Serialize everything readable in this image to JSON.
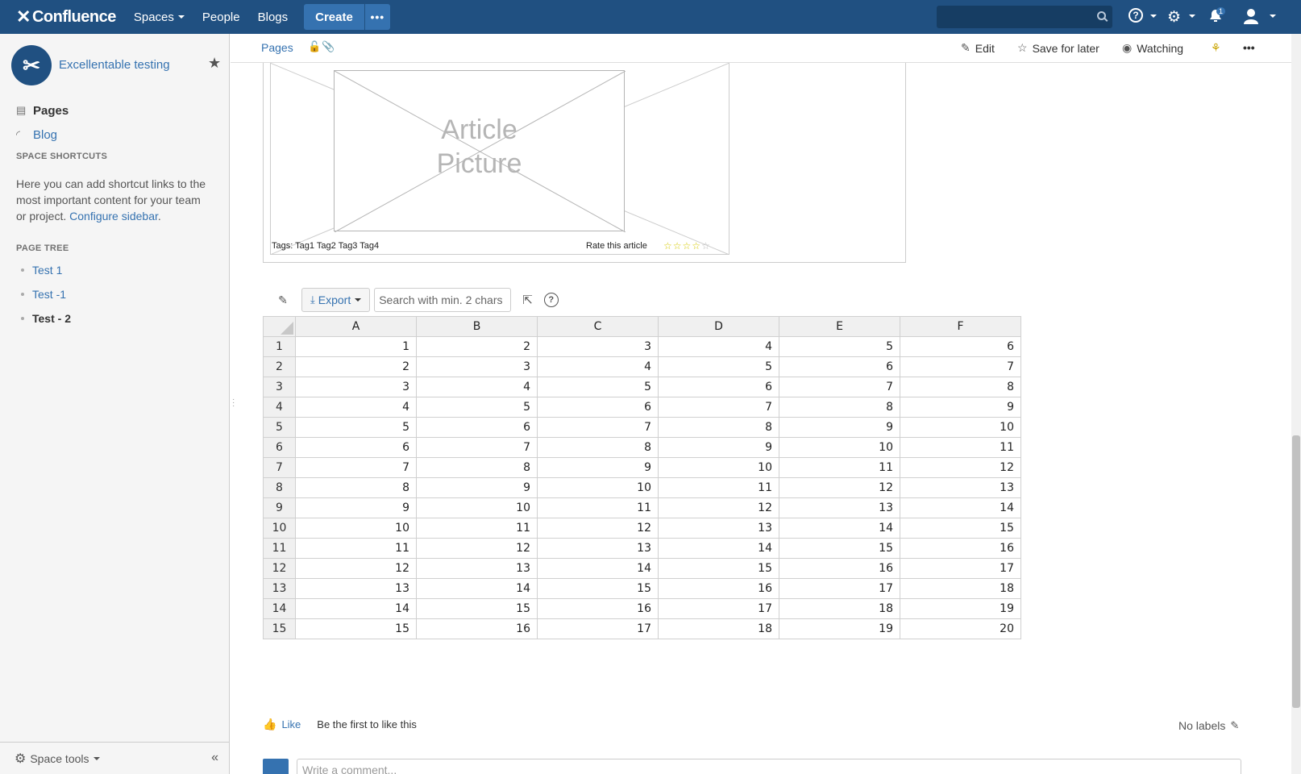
{
  "topnav": {
    "logo": "Confluence",
    "links": [
      "Spaces",
      "People",
      "Blogs"
    ],
    "create_label": "Create",
    "more_label": "•••",
    "notifications_count": "1"
  },
  "sidebar": {
    "space_name": "Excellentable testing",
    "nav": {
      "pages": "Pages",
      "blog": "Blog"
    },
    "shortcuts_heading": "SPACE SHORTCUTS",
    "shortcuts_text": "Here you can add shortcut links to the most important content for your team or project.",
    "configure_link": "Configure sidebar",
    "tree_heading": "PAGE TREE",
    "tree": [
      "Test 1",
      "Test -1",
      "Test - 2"
    ],
    "space_tools": "Space tools"
  },
  "page_header": {
    "breadcrumb": "Pages",
    "edit": "Edit",
    "save_for_later": "Save for later",
    "watching": "Watching"
  },
  "article": {
    "picture_line1": "Article",
    "picture_line2": "Picture",
    "tags": "Tags: Tag1 Tag2 Tag3 Tag4",
    "rate": "Rate this article",
    "rating": 4,
    "rating_max": 5
  },
  "table_toolbar": {
    "export_label": "Export",
    "search_placeholder": "Search with min. 2 chars"
  },
  "sheet": {
    "columns": [
      "A",
      "B",
      "C",
      "D",
      "E",
      "F"
    ],
    "rows": [
      [
        "1",
        "1",
        "2",
        "3",
        "4",
        "5",
        "6"
      ],
      [
        "2",
        "2",
        "3",
        "4",
        "5",
        "6",
        "7"
      ],
      [
        "3",
        "3",
        "4",
        "5",
        "6",
        "7",
        "8"
      ],
      [
        "4",
        "4",
        "5",
        "6",
        "7",
        "8",
        "9"
      ],
      [
        "5",
        "5",
        "6",
        "7",
        "8",
        "9",
        "10"
      ],
      [
        "6",
        "6",
        "7",
        "8",
        "9",
        "10",
        "11"
      ],
      [
        "7",
        "7",
        "8",
        "9",
        "10",
        "11",
        "12"
      ],
      [
        "8",
        "8",
        "9",
        "10",
        "11",
        "12",
        "13"
      ],
      [
        "9",
        "9",
        "10",
        "11",
        "12",
        "13",
        "14"
      ],
      [
        "10",
        "10",
        "11",
        "12",
        "13",
        "14",
        "15"
      ],
      [
        "11",
        "11",
        "12",
        "13",
        "14",
        "15",
        "16"
      ],
      [
        "12",
        "12",
        "13",
        "14",
        "15",
        "16",
        "17"
      ],
      [
        "13",
        "13",
        "14",
        "15",
        "16",
        "17",
        "18"
      ],
      [
        "14",
        "14",
        "15",
        "16",
        "17",
        "18",
        "19"
      ],
      [
        "15",
        "15",
        "16",
        "17",
        "18",
        "19",
        "20"
      ]
    ]
  },
  "footer": {
    "like": "Like",
    "like_note": "Be the first to like this",
    "labels": "No labels",
    "comment_placeholder": "Write a comment..."
  },
  "icons": [
    "search-icon",
    "help-icon",
    "gear-icon",
    "notification-icon",
    "user-icon",
    "star-icon",
    "pages-icon",
    "rss-icon",
    "lock-icon",
    "paperclip-icon",
    "pencil-icon",
    "star-outline-icon",
    "eye-icon",
    "share-icon",
    "more-icon",
    "thumbs-up-icon",
    "export-icon",
    "collapse-icon"
  ],
  "colors": {
    "nav": "#205081",
    "accent": "#3572b0"
  }
}
